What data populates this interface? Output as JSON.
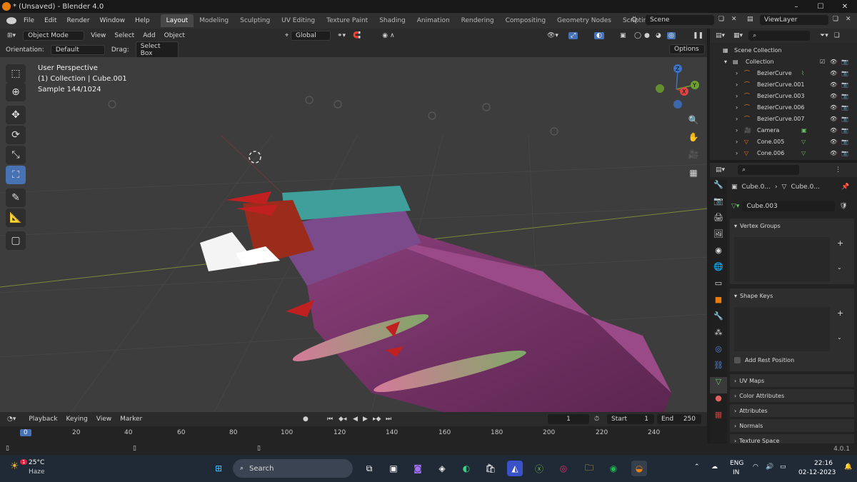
{
  "title_bar": {
    "title": "* (Unsaved) - Blender 4.0",
    "minimize": "–",
    "maximize": "☐",
    "close": "✕"
  },
  "menu": [
    "File",
    "Edit",
    "Render",
    "Window",
    "Help"
  ],
  "workspaces": [
    "Layout",
    "Modeling",
    "Sculpting",
    "UV Editing",
    "Texture Paint",
    "Shading",
    "Animation",
    "Rendering",
    "Compositing",
    "Geometry Nodes",
    "Scripting"
  ],
  "add_workspace": "+",
  "scene": {
    "label": "Scene",
    "view_layer": "ViewLayer"
  },
  "viewport_header": {
    "mode": "Object Mode",
    "menus": [
      "View",
      "Select",
      "Add",
      "Object"
    ],
    "transform": "Global",
    "orientation_label": "Orientation:",
    "orientation_value": "Default",
    "drag_label": "Drag:",
    "drag_value": "Select Box",
    "options": "Options"
  },
  "viewport_info": {
    "line1": "User Perspective",
    "line2": "(1) Collection | Cube.001",
    "line3": "Sample 144/1024"
  },
  "gizmo": {
    "z": "Z",
    "y": "Y",
    "x": "X"
  },
  "timeline": {
    "menus": [
      "Playback",
      "Keying",
      "View",
      "Marker"
    ],
    "current_frame": "1",
    "start_label": "Start",
    "start": "1",
    "end_label": "End",
    "end": "250",
    "ticks": [
      "0",
      "20",
      "40",
      "60",
      "80",
      "100",
      "120",
      "140",
      "160",
      "180",
      "200",
      "220",
      "240"
    ]
  },
  "outliner": {
    "root": "Scene Collection",
    "collection": "Collection",
    "items": [
      {
        "name": "BezierCurve",
        "icon": "curve-icon"
      },
      {
        "name": "BezierCurve.001",
        "icon": "curve-icon"
      },
      {
        "name": "BezierCurve.003",
        "icon": "curve-icon"
      },
      {
        "name": "BezierCurve.006",
        "icon": "curve-icon"
      },
      {
        "name": "BezierCurve.007",
        "icon": "curve-icon"
      },
      {
        "name": "Camera",
        "icon": "camera-icon"
      },
      {
        "name": "Cone.005",
        "icon": "cone-icon"
      },
      {
        "name": "Cone.006",
        "icon": "cone-icon"
      }
    ]
  },
  "properties": {
    "breadcrumb_object": "Cube.0...",
    "breadcrumb_data": "Cube.0...",
    "mesh_name": "Cube.003",
    "panels": [
      "Vertex Groups",
      "Shape Keys",
      "UV Maps",
      "Color Attributes",
      "Attributes",
      "Normals",
      "Texture Space"
    ],
    "add_rest_position": "Add Rest Position"
  },
  "status_bar": {
    "version": "4.0.1"
  },
  "taskbar": {
    "weather_temp": "25°C",
    "weather_desc": "Haze",
    "weather_badge": "1",
    "search": "Search",
    "lang": "ENG",
    "region": "IN",
    "time": "22:16",
    "date": "02-12-2023"
  },
  "colors": {
    "accent": "#4772b3",
    "brand": "#e87d0d",
    "object_orange": "#e87d0d",
    "data_green": "#6dbf6a"
  }
}
